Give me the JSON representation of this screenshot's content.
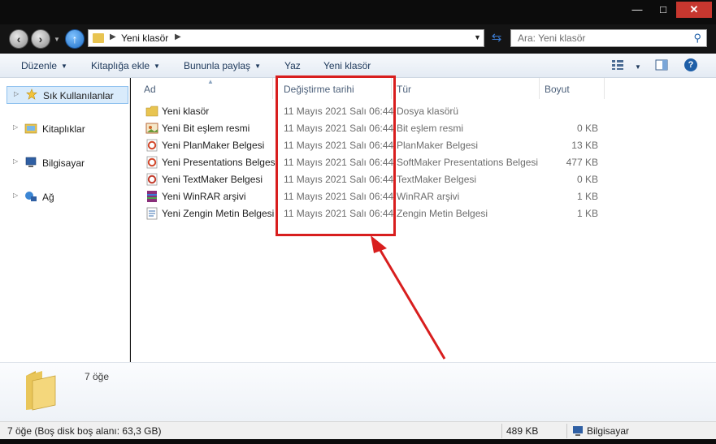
{
  "window": {
    "minimize_glyph": "—",
    "maximize_glyph": "□",
    "close_glyph": "✕"
  },
  "address_bar": {
    "path": "Yeni klasör",
    "search_placeholder": "Ara: Yeni klasör"
  },
  "toolbar": {
    "organize": "Düzenle",
    "include_in_library": "Kitaplığa ekle",
    "share_with": "Bununla paylaş",
    "burn": "Yaz",
    "new_folder": "Yeni klasör",
    "help": "?"
  },
  "sidebar": {
    "items": [
      {
        "label": "Sık Kullanılanlar",
        "icon": "star-icon"
      },
      {
        "label": "Kitaplıklar",
        "icon": "libraries-icon"
      },
      {
        "label": "Bilgisayar",
        "icon": "computer-icon"
      },
      {
        "label": "Ağ",
        "icon": "network-icon"
      }
    ]
  },
  "columns": {
    "name": "Ad",
    "date_modified": "Değiştirme tarihi",
    "type": "Tür",
    "size": "Boyut"
  },
  "files": [
    {
      "name": "Yeni klasör",
      "date": "11 Mayıs 2021 Salı 06:44",
      "type": "Dosya klasörü",
      "size": "",
      "icon": "folder-icon",
      "icon_color": "#e8c451"
    },
    {
      "name": "Yeni Bit eşlem resmi",
      "date": "11 Mayıs 2021 Salı 06:44",
      "type": "Bit eşlem resmi",
      "size": "0 KB",
      "icon": "bitmap-icon",
      "icon_color": "#b86a3a"
    },
    {
      "name": "Yeni PlanMaker Belgesi",
      "date": "11 Mayıs 2021 Salı 06:44",
      "type": "PlanMaker Belgesi",
      "size": "13 KB",
      "icon": "planmaker-icon",
      "icon_color": "#d2472a"
    },
    {
      "name": "Yeni Presentations Belgesi",
      "date": "11 Mayıs 2021 Salı 06:44",
      "type": "SoftMaker Presentations Belgesi",
      "size": "477 KB",
      "icon": "presentations-icon",
      "icon_color": "#d2472a"
    },
    {
      "name": "Yeni TextMaker Belgesi",
      "date": "11 Mayıs 2021 Salı 06:44",
      "type": "TextMaker Belgesi",
      "size": "0 KB",
      "icon": "textmaker-icon",
      "icon_color": "#c23a2a"
    },
    {
      "name": "Yeni WinRAR arşivi",
      "date": "11 Mayıs 2021 Salı 06:44",
      "type": "WinRAR arşivi",
      "size": "1 KB",
      "icon": "winrar-icon",
      "icon_color": "#8a2f7a"
    },
    {
      "name": "Yeni Zengin Metin Belgesi",
      "date": "11 Mayıs 2021 Salı 06:44",
      "type": "Zengin Metin Belgesi",
      "size": "1 KB",
      "icon": "rtf-icon",
      "icon_color": "#3a6fb0"
    }
  ],
  "details_pane": {
    "item_count": "7 öğe"
  },
  "status_bar": {
    "summary": "7 öğe (Boş disk boş alanı: 63,3 GB)",
    "total_size": "489 KB",
    "location": "Bilgisayar"
  },
  "annotation": {
    "color": "#d81e1e"
  }
}
